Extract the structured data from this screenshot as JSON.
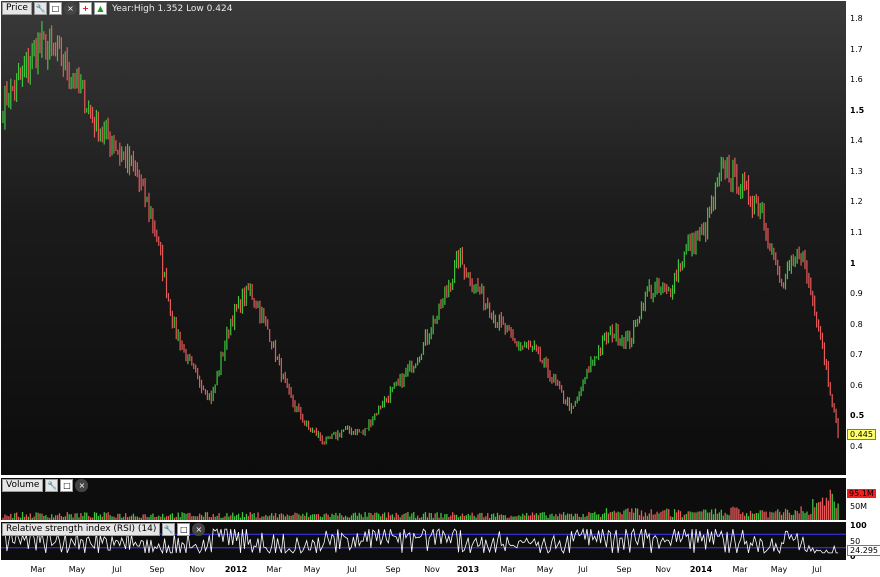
{
  "price_panel": {
    "label": "Price",
    "icons": [
      "wrench-icon",
      "maximize-icon",
      "close-icon",
      "red-plus-icon",
      "green-up-icon"
    ],
    "info": "Year:High 1.352 Low 0.424",
    "last_price": "0.445",
    "up_color": "#3ec43e",
    "down_color": "#e55a5a",
    "axis_ticks": [
      {
        "label": "1.8",
        "value": 1.8,
        "bold": false
      },
      {
        "label": "1.7",
        "value": 1.7,
        "bold": false
      },
      {
        "label": "1.6",
        "value": 1.6,
        "bold": false
      },
      {
        "label": "1.5",
        "value": 1.5,
        "bold": true
      },
      {
        "label": "1.4",
        "value": 1.4,
        "bold": false
      },
      {
        "label": "1.3",
        "value": 1.3,
        "bold": false
      },
      {
        "label": "1.2",
        "value": 1.2,
        "bold": false
      },
      {
        "label": "1.1",
        "value": 1.1,
        "bold": false
      },
      {
        "label": "1",
        "value": 1.0,
        "bold": true
      },
      {
        "label": "0.9",
        "value": 0.9,
        "bold": false
      },
      {
        "label": "0.8",
        "value": 0.8,
        "bold": false
      },
      {
        "label": "0.7",
        "value": 0.7,
        "bold": false
      },
      {
        "label": "0.6",
        "value": 0.6,
        "bold": false
      },
      {
        "label": "0.5",
        "value": 0.5,
        "bold": true
      },
      {
        "label": "0.4",
        "value": 0.4,
        "bold": false
      }
    ]
  },
  "volume_panel": {
    "label": "Volume",
    "icons": [
      "wrench-icon",
      "maximize-icon",
      "close-icon"
    ],
    "last_value": "95.1M",
    "axis_ticks": [
      {
        "label": "50M",
        "value": 50
      }
    ]
  },
  "rsi_panel": {
    "label": "Relative strength index (RSI) (14)",
    "icons": [
      "wrench-icon",
      "maximize-icon",
      "close-icon"
    ],
    "last_value": "24.295",
    "axis_ticks": [
      {
        "label": "100",
        "value": 100
      },
      {
        "label": "50",
        "value": 50
      },
      {
        "label": "0",
        "value": 0
      }
    ],
    "levels": [
      70,
      30
    ],
    "line_color": "#ffffff",
    "level_color": "#3a3aff"
  },
  "time_axis": [
    {
      "label": "Mar",
      "bold": false
    },
    {
      "label": "May",
      "bold": false
    },
    {
      "label": "Jul",
      "bold": false
    },
    {
      "label": "Sep",
      "bold": false
    },
    {
      "label": "Nov",
      "bold": false
    },
    {
      "label": "2012",
      "bold": true
    },
    {
      "label": "Mar",
      "bold": false
    },
    {
      "label": "May",
      "bold": false
    },
    {
      "label": "Jul",
      "bold": false
    },
    {
      "label": "Sep",
      "bold": false
    },
    {
      "label": "Nov",
      "bold": false
    },
    {
      "label": "2013",
      "bold": true
    },
    {
      "label": "Mar",
      "bold": false
    },
    {
      "label": "May",
      "bold": false
    },
    {
      "label": "Jul",
      "bold": false
    },
    {
      "label": "Sep",
      "bold": false
    },
    {
      "label": "Nov",
      "bold": false
    },
    {
      "label": "2014",
      "bold": true
    },
    {
      "label": "Mar",
      "bold": false
    },
    {
      "label": "May",
      "bold": false
    },
    {
      "label": "Jul",
      "bold": false
    }
  ],
  "chart_data": {
    "type": "line",
    "price_ylim": [
      0.35,
      1.85
    ],
    "price_path": [
      [
        "2011-01",
        1.52
      ],
      [
        "2011-02",
        1.62
      ],
      [
        "2011-03",
        1.72
      ],
      [
        "2011-04",
        1.68
      ],
      [
        "2011-05",
        1.58
      ],
      [
        "2011-06",
        1.45
      ],
      [
        "2011-07",
        1.38
      ],
      [
        "2011-08",
        1.3
      ],
      [
        "2011-09",
        1.12
      ],
      [
        "2011-10",
        0.8
      ],
      [
        "2011-11",
        0.65
      ],
      [
        "2011-12",
        0.56
      ],
      [
        "2012-01",
        0.82
      ],
      [
        "2012-02",
        0.92
      ],
      [
        "2012-03",
        0.78
      ],
      [
        "2012-04",
        0.58
      ],
      [
        "2012-05",
        0.47
      ],
      [
        "2012-06",
        0.42
      ],
      [
        "2012-07",
        0.46
      ],
      [
        "2012-08",
        0.45
      ],
      [
        "2012-09",
        0.55
      ],
      [
        "2012-10",
        0.62
      ],
      [
        "2012-11",
        0.72
      ],
      [
        "2012-12",
        0.85
      ],
      [
        "2013-01",
        1.02
      ],
      [
        "2013-02",
        0.92
      ],
      [
        "2013-03",
        0.82
      ],
      [
        "2013-04",
        0.74
      ],
      [
        "2013-05",
        0.72
      ],
      [
        "2013-06",
        0.62
      ],
      [
        "2013-07",
        0.52
      ],
      [
        "2013-08",
        0.68
      ],
      [
        "2013-09",
        0.78
      ],
      [
        "2013-10",
        0.75
      ],
      [
        "2013-11",
        0.92
      ],
      [
        "2013-12",
        0.9
      ],
      [
        "2014-01",
        1.05
      ],
      [
        "2014-02",
        1.12
      ],
      [
        "2014-03",
        1.32
      ],
      [
        "2014-04",
        1.25
      ],
      [
        "2014-05",
        1.18
      ],
      [
        "2014-06",
        0.92
      ],
      [
        "2014-07",
        1.05
      ],
      [
        "2014-07b",
        0.8
      ],
      [
        "2014-08",
        0.445
      ]
    ]
  }
}
